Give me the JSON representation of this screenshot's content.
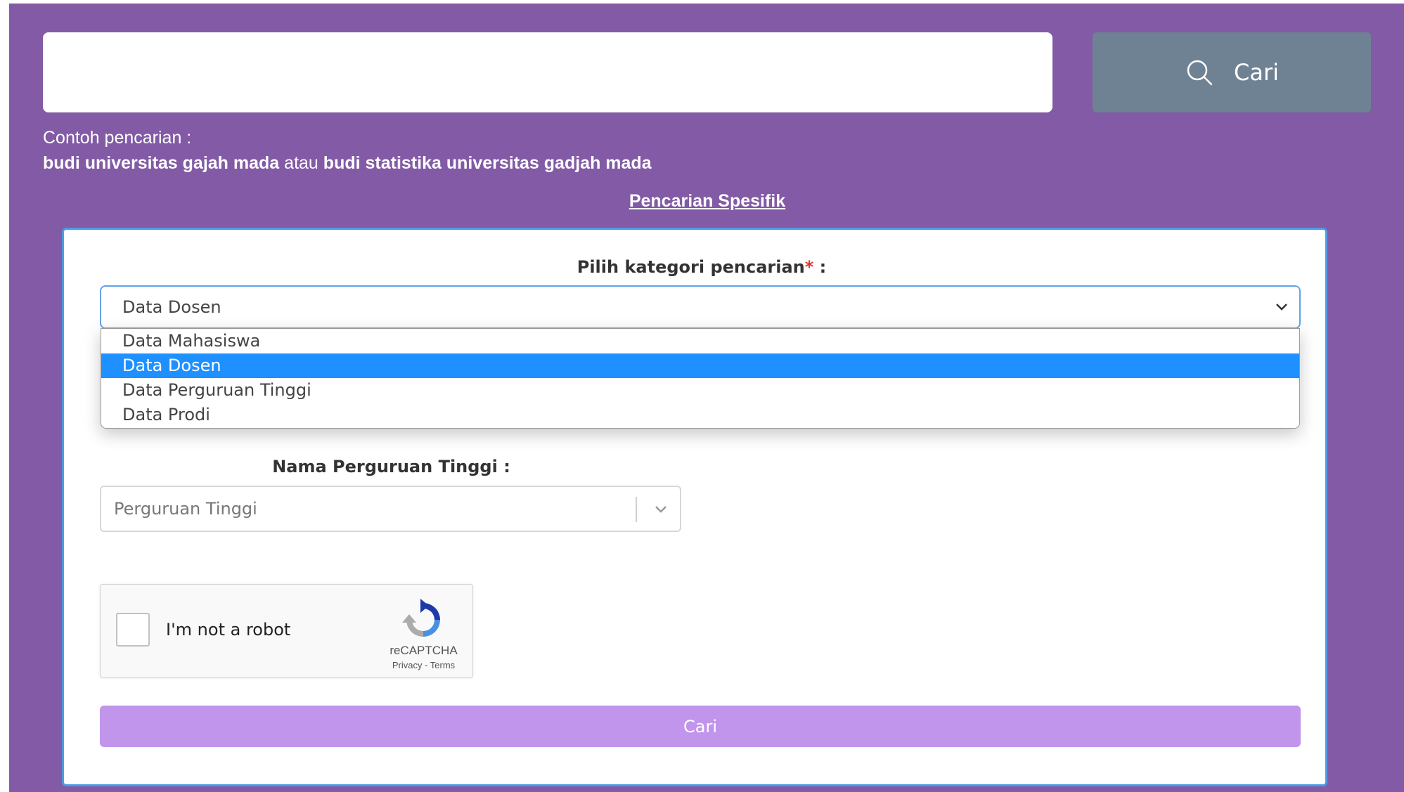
{
  "search": {
    "query": "",
    "button_label": "Cari",
    "button_icon": "search-icon"
  },
  "examples": {
    "title": "Contoh pencarian :",
    "example_1": "budi universitas gajah mada",
    "connector": "atau",
    "example_2": "budi statistika universitas gadjah mada"
  },
  "specific_search_link": "Pencarian Spesifik",
  "form": {
    "category_label": "Pilih kategori pencarian",
    "required_mark": "*",
    "label_suffix": " :",
    "category_selected": "Data Dosen",
    "category_options": [
      {
        "label": "Data Mahasiswa",
        "selected": false
      },
      {
        "label": "Data Dosen",
        "selected": true
      },
      {
        "label": "Data Perguruan Tinggi",
        "selected": false
      },
      {
        "label": "Data Prodi",
        "selected": false
      }
    ],
    "university_label": "Nama Perguruan Tinggi :",
    "university_placeholder": "Perguruan Tinggi",
    "captcha": {
      "label": "I'm not a robot",
      "brand": "reCAPTCHA",
      "privacy": "Privacy",
      "separator": " - ",
      "terms": "Terms"
    },
    "submit_label": "Cari"
  },
  "colors": {
    "page_background": "#825aa5",
    "search_button": "#6f8294",
    "card_border": "#4d9be4",
    "selected_option": "#1e90ff",
    "submit_button": "#c095eb",
    "required": "#e0342d"
  }
}
